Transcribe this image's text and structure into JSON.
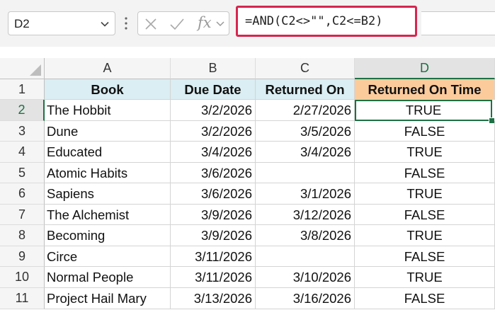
{
  "name_box": {
    "value": "D2"
  },
  "formula_bar": {
    "fx_label": "fx",
    "formula": "=AND(C2<>\"\",C2<=B2)"
  },
  "columns": [
    "A",
    "B",
    "C",
    "D"
  ],
  "selected_column": "D",
  "selected_row": "2",
  "headers": {
    "row_number": "1",
    "cells": [
      "Book",
      "Due Date",
      "Returned On",
      "Returned On Time"
    ]
  },
  "rows": [
    {
      "num": "2",
      "book": "The Hobbit",
      "due": "3/2/2026",
      "returned": "2/27/2026",
      "on_time": "TRUE"
    },
    {
      "num": "3",
      "book": "Dune",
      "due": "3/2/2026",
      "returned": "3/5/2026",
      "on_time": "FALSE"
    },
    {
      "num": "4",
      "book": "Educated",
      "due": "3/4/2026",
      "returned": "3/4/2026",
      "on_time": "TRUE"
    },
    {
      "num": "5",
      "book": "Atomic Habits",
      "due": "3/6/2026",
      "returned": "",
      "on_time": "FALSE"
    },
    {
      "num": "6",
      "book": "Sapiens",
      "due": "3/6/2026",
      "returned": "3/1/2026",
      "on_time": "TRUE"
    },
    {
      "num": "7",
      "book": "The Alchemist",
      "due": "3/9/2026",
      "returned": "3/12/2026",
      "on_time": "FALSE"
    },
    {
      "num": "8",
      "book": "Becoming",
      "due": "3/9/2026",
      "returned": "3/8/2026",
      "on_time": "TRUE"
    },
    {
      "num": "9",
      "book": "Circe",
      "due": "3/11/2026",
      "returned": "",
      "on_time": "FALSE"
    },
    {
      "num": "10",
      "book": "Normal People",
      "due": "3/11/2026",
      "returned": "3/10/2026",
      "on_time": "TRUE"
    },
    {
      "num": "11",
      "book": "Project Hail Mary",
      "due": "3/13/2026",
      "returned": "3/16/2026",
      "on_time": "FALSE"
    }
  ],
  "colors": {
    "header_blue": "#daeef3",
    "header_orange": "#fbcb9c",
    "selection_green": "#1e7145",
    "formula_highlight": "#d6264e"
  },
  "icons": [
    "chevron-down-icon",
    "more-options-icon",
    "cancel-icon",
    "enter-icon",
    "function-icon",
    "expand-icon"
  ]
}
